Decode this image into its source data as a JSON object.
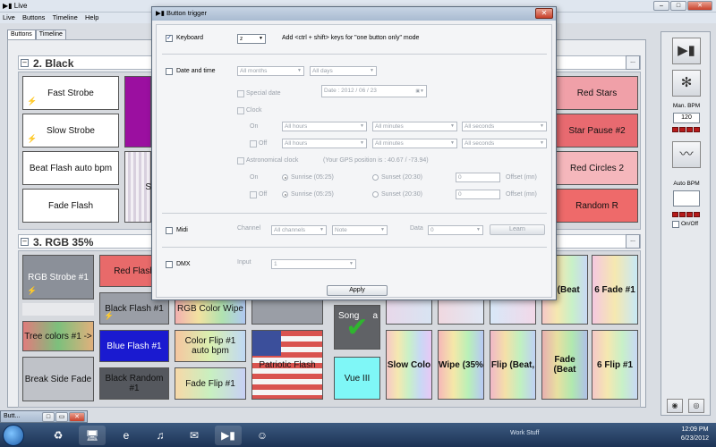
{
  "app": {
    "title": "Live",
    "menu": [
      "Live",
      "Buttons",
      "Timeline",
      "Help"
    ],
    "tabs": [
      "Buttons",
      "Timeline"
    ]
  },
  "groups": [
    {
      "label": "2. Black"
    },
    {
      "label": "3. RGB 35%"
    }
  ],
  "group2_tiles": {
    "left": [
      "Fast Strobe",
      "Slow Strobe",
      "Beat Flash auto bpm",
      "Fade Flash"
    ],
    "partial_s": "S",
    "right": [
      "Red Stars",
      "Star Pause #2",
      "Red Circles 2",
      "Random R"
    ]
  },
  "group3_tiles": {
    "col1": [
      "RGB Strobe #1",
      "Tree colors #1 ->",
      "Break Side Fade"
    ],
    "col2": [
      "Red Flash",
      "Black Flash #1",
      "Blue Flash #1",
      "Black Random #1"
    ],
    "col3": [
      "RGB Color Wipe",
      "Color Flip #1 auto bpm",
      "Fade Flip #1"
    ],
    "col4": [
      "Patriotic Flash"
    ],
    "partial_song": "Song",
    "partial_a": "a",
    "vue": "Vue III",
    "row_right": [
      "Slow Colo",
      "Wipe (35%",
      "Flip (Beat,",
      "Fade (Beat",
      "6 Flip #1"
    ],
    "row_right_top": [
      "e (Beat",
      "6 Fade #1"
    ]
  },
  "side": {
    "man_bpm_label": "Man. BPM",
    "man_bpm_value": "120",
    "auto_bpm_label": "Auto BPM",
    "on_off": "On/Off"
  },
  "dialog": {
    "title": "Button trigger",
    "keyboard": {
      "label": "Keyboard",
      "key": "z",
      "hint": "Add <ctrl + shift> keys for \"one button only\" mode"
    },
    "datetime": {
      "label": "Date and time",
      "months": "All months",
      "days": "All days",
      "special_date": "Special date",
      "date_value": "Date : 2012 / 06 / 23",
      "clock": "Clock",
      "on": "On",
      "off": "Off",
      "hours": "All hours",
      "minutes": "All minutes",
      "seconds": "All seconds",
      "astro": "Astronomical clock",
      "gps": "(Your GPS position is : 40.67 / -73.94)",
      "sunrise": "Sunrise (05:25)",
      "sunset": "Sunset (20:30)",
      "offset_value": "0",
      "offset_label": "Offset (mn)"
    },
    "midi": {
      "label": "Midi",
      "channel_label": "Channel",
      "channel": "All channels",
      "note": "Note",
      "data_label": "Data",
      "data": "0",
      "learn": "Learn"
    },
    "dmx": {
      "label": "DMX",
      "input_label": "Input",
      "input": "1"
    },
    "apply": "Apply"
  },
  "mini_window": {
    "title": "Butt..."
  },
  "taskbar": {
    "workspace": "Work Stuff",
    "time": "12:09 PM",
    "date": "6/23/2012"
  }
}
